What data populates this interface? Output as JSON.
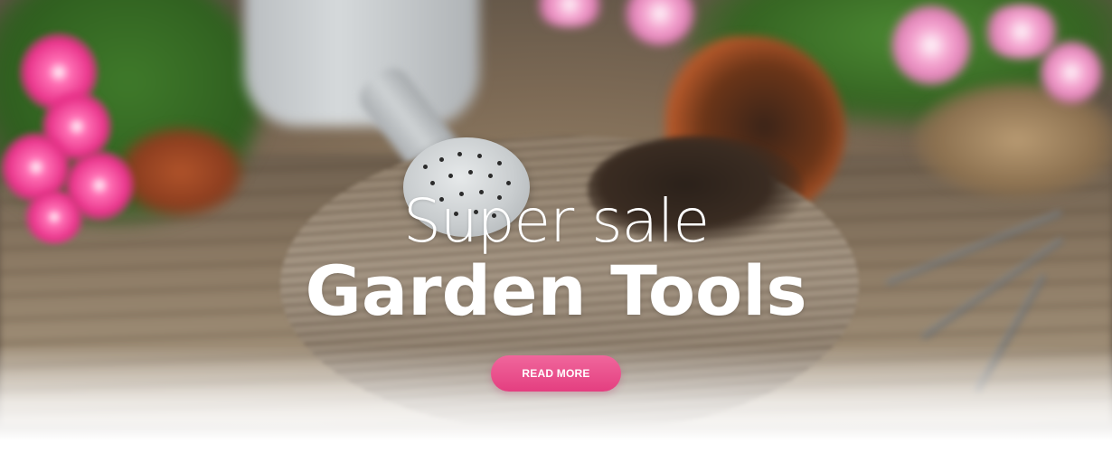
{
  "hero": {
    "headline_light": "Super sale",
    "headline_bold": "Garden Tools",
    "cta_label": "READ MORE"
  },
  "colors": {
    "cta_pink": "#e8478a",
    "text": "#ffffff"
  },
  "icons": [
    "flower",
    "watering-can",
    "garden-fork",
    "plant-pot"
  ]
}
